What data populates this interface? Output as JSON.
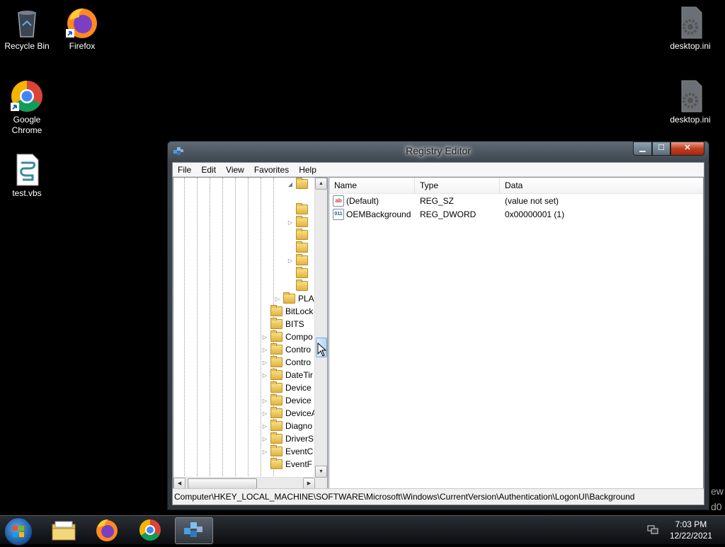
{
  "desktop": {
    "icons": [
      {
        "label": "Recycle Bin",
        "icon": "recycle-bin-icon"
      },
      {
        "label": "Firefox",
        "icon": "firefox-icon"
      },
      {
        "label": "Google Chrome",
        "icon": "chrome-icon"
      },
      {
        "label": "test.vbs",
        "icon": "vbs-script-icon"
      },
      {
        "label": "desktop.ini",
        "icon": "ini-file-icon"
      },
      {
        "label": "desktop.ini",
        "icon": "ini-file-icon"
      }
    ],
    "edge_fragments": [
      "ew",
      "d0"
    ]
  },
  "window": {
    "title": "Registry Editor",
    "buttons": {
      "minimize": "▁",
      "maximize": "☐",
      "close": "✕"
    },
    "menu": [
      "File",
      "Edit",
      "View",
      "Favorites",
      "Help"
    ],
    "tree": {
      "items": [
        {
          "label": "",
          "expander": "◢"
        },
        {
          "label": "",
          "expander": ""
        },
        {
          "label": "",
          "expander": ""
        },
        {
          "label": "",
          "expander": "▷"
        },
        {
          "label": "",
          "expander": ""
        },
        {
          "label": "",
          "expander": ""
        },
        {
          "label": "",
          "expander": "▷"
        },
        {
          "label": "",
          "expander": ""
        },
        {
          "label": "",
          "expander": ""
        },
        {
          "label": "PLA",
          "expander": "▷"
        },
        {
          "label": "BitLock",
          "expander": ""
        },
        {
          "label": "BITS",
          "expander": ""
        },
        {
          "label": "Compo",
          "expander": "▷"
        },
        {
          "label": "Contro",
          "expander": "▷"
        },
        {
          "label": "Contro",
          "expander": "▷"
        },
        {
          "label": "DateTir",
          "expander": "▷"
        },
        {
          "label": "Device",
          "expander": ""
        },
        {
          "label": "Device",
          "expander": "▷"
        },
        {
          "label": "DeviceA",
          "expander": "▷"
        },
        {
          "label": "Diagno",
          "expander": "▷"
        },
        {
          "label": "DriverS",
          "expander": "▷"
        },
        {
          "label": "EventC",
          "expander": "▷"
        },
        {
          "label": "EventF",
          "expander": ""
        }
      ]
    },
    "list": {
      "columns": [
        "Name",
        "Type",
        "Data"
      ],
      "rows": [
        {
          "icon": "string-value-icon",
          "icon_text": "ab",
          "name": "(Default)",
          "type": "REG_SZ",
          "data": "(value not set)"
        },
        {
          "icon": "binary-value-icon",
          "icon_text": "011",
          "name": "OEMBackground",
          "type": "REG_DWORD",
          "data": "0x00000001 (1)"
        }
      ]
    },
    "status": "Computer\\HKEY_LOCAL_MACHINE\\SOFTWARE\\Microsoft\\Windows\\CurrentVersion\\Authentication\\LogonUI\\Background"
  },
  "taskbar": {
    "items": [
      {
        "icon": "windows-start-icon"
      },
      {
        "icon": "file-explorer-icon"
      },
      {
        "icon": "firefox-icon"
      },
      {
        "icon": "chrome-icon"
      },
      {
        "icon": "registry-editor-icon",
        "active": true
      }
    ],
    "clock": {
      "time": "7:03 PM",
      "date": "12/22/2021"
    }
  }
}
